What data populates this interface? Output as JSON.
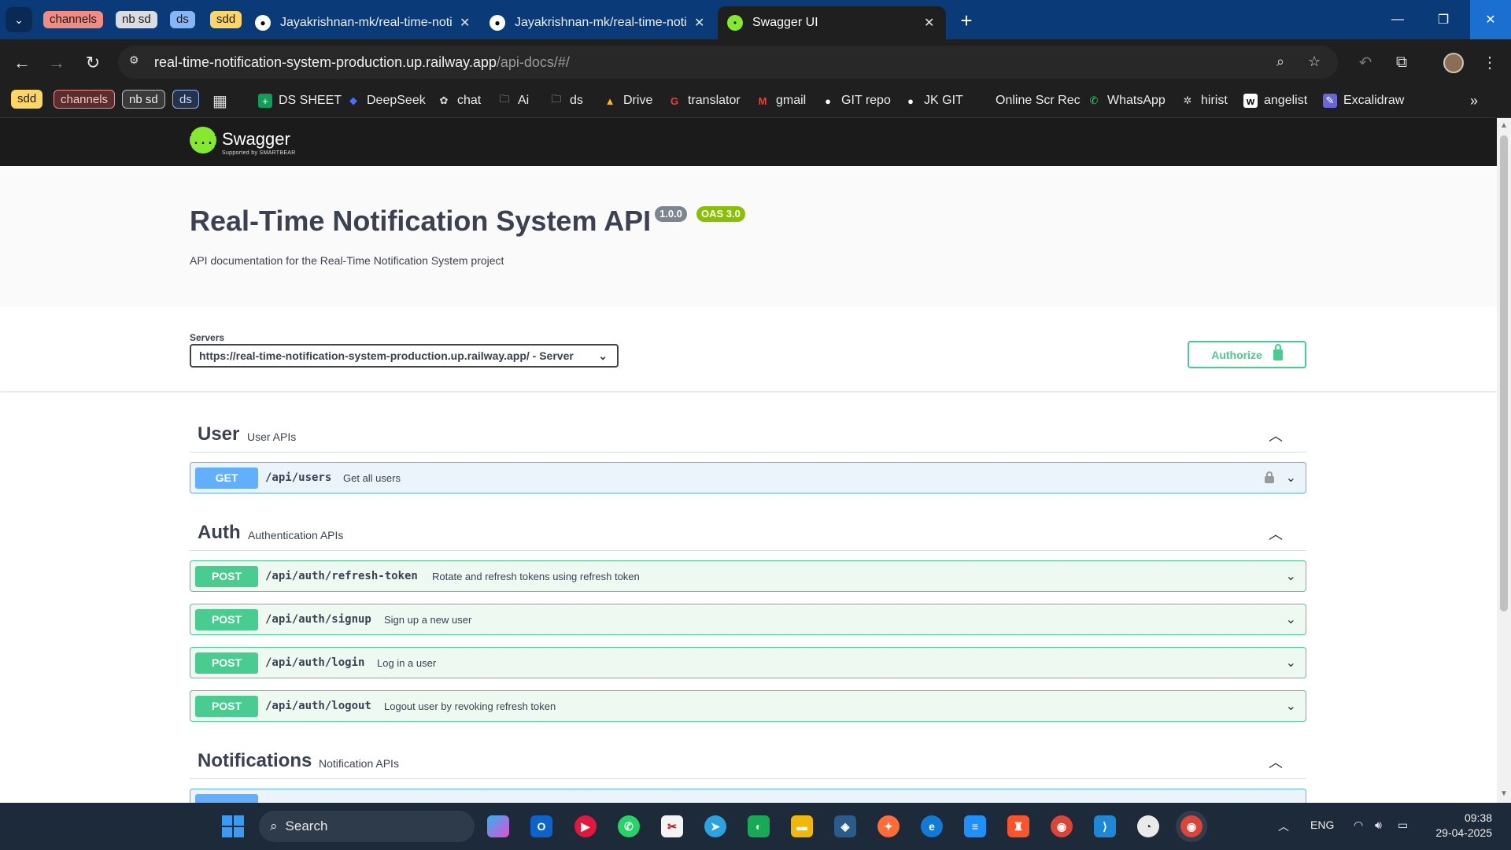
{
  "browser": {
    "tab_groups": [
      {
        "label": "channels",
        "color": "#f28b82"
      },
      {
        "label": "nb sd",
        "color": "#dadce0"
      },
      {
        "label": "ds",
        "color": "#8ab4f8"
      },
      {
        "label": "sdd",
        "color": "#fdd663"
      }
    ],
    "tabs": [
      {
        "title": "Jayakrishnan-mk/real-time-noti",
        "icon": "github-icon",
        "active": false
      },
      {
        "title": "Jayakrishnan-mk/real-time-noti",
        "icon": "github-icon",
        "active": false
      },
      {
        "title": "Swagger UI",
        "icon": "swagger-icon",
        "active": true
      }
    ],
    "url_host": "real-time-notification-system-production.up.railway.app",
    "url_path": "/api-docs/#/",
    "bookmark_groups": [
      {
        "label": "sdd",
        "color": "#fdd663"
      },
      {
        "label": "channels",
        "color": "#f28b82"
      },
      {
        "label": "nb sd",
        "color": "#dadce0"
      },
      {
        "label": "ds",
        "color": "#8ab4f8"
      }
    ],
    "bookmarks": [
      {
        "label": "DS SHEET",
        "icon": "sheets-icon"
      },
      {
        "label": "DeepSeek",
        "icon": "deepseek-icon"
      },
      {
        "label": "chat",
        "icon": "chatgpt-icon"
      },
      {
        "label": "Ai",
        "icon": "folder-icon"
      },
      {
        "label": "ds",
        "icon": "folder-icon"
      },
      {
        "label": "Drive",
        "icon": "drive-icon"
      },
      {
        "label": "translator",
        "icon": "google-icon"
      },
      {
        "label": "gmail",
        "icon": "gmail-icon"
      },
      {
        "label": "GIT repo",
        "icon": "github-icon"
      },
      {
        "label": "JK GIT",
        "icon": "github-icon"
      },
      {
        "label": "Online Scr Rec",
        "icon": "blank-icon"
      },
      {
        "label": "WhatsApp",
        "icon": "whatsapp-icon"
      },
      {
        "label": "hirist",
        "icon": "hirist-icon"
      },
      {
        "label": "angelist",
        "icon": "angelist-icon"
      },
      {
        "label": "Excalidraw",
        "icon": "excalidraw-icon"
      }
    ]
  },
  "swagger": {
    "brand": "Swagger",
    "brand_sub": "Supported by SMARTBEAR",
    "logo_glyph": "{...}",
    "title": "Real-Time Notification System API",
    "version": "1.0.0",
    "oas": "OAS 3.0",
    "description": "API documentation for the Real-Time Notification System project",
    "servers_label": "Servers",
    "server_selected": "https://real-time-notification-system-production.up.railway.app/ - Server",
    "authorize_label": "Authorize",
    "colors": {
      "get": "#61affe",
      "post": "#49cc90",
      "topbar": "#1b1b1b",
      "logo": "#85ea2d"
    },
    "tags": [
      {
        "name": "User",
        "description": "User APIs"
      },
      {
        "name": "Auth",
        "description": "Authentication APIs"
      },
      {
        "name": "Notifications",
        "description": "Notification APIs"
      }
    ],
    "operations": [
      {
        "method": "GET",
        "path": "/api/users",
        "summary": "Get all users",
        "locked": true
      },
      {
        "method": "POST",
        "path": "/api/auth/refresh-token",
        "summary": "Rotate and refresh tokens using refresh token",
        "locked": false
      },
      {
        "method": "POST",
        "path": "/api/auth/signup",
        "summary": "Sign up a new user",
        "locked": false
      },
      {
        "method": "POST",
        "path": "/api/auth/login",
        "summary": "Log in a user",
        "locked": false
      },
      {
        "method": "POST",
        "path": "/api/auth/logout",
        "summary": "Logout user by revoking refresh token",
        "locked": false
      }
    ]
  },
  "taskbar": {
    "search_label": "Search",
    "language": "ENG",
    "time": "09:38",
    "date": "29-04-2025"
  }
}
